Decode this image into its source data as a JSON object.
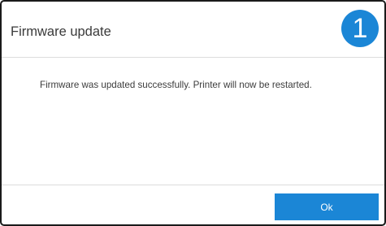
{
  "dialog": {
    "title": "Firmware update",
    "step_badge": "1",
    "message": "Firmware was updated successfully. Printer will now be restarted.",
    "ok_label": "Ok"
  },
  "colors": {
    "accent": "#1b86d6",
    "border": "#1a1a1a",
    "divider": "#dcdcdc",
    "text": "#3a3a3a"
  }
}
